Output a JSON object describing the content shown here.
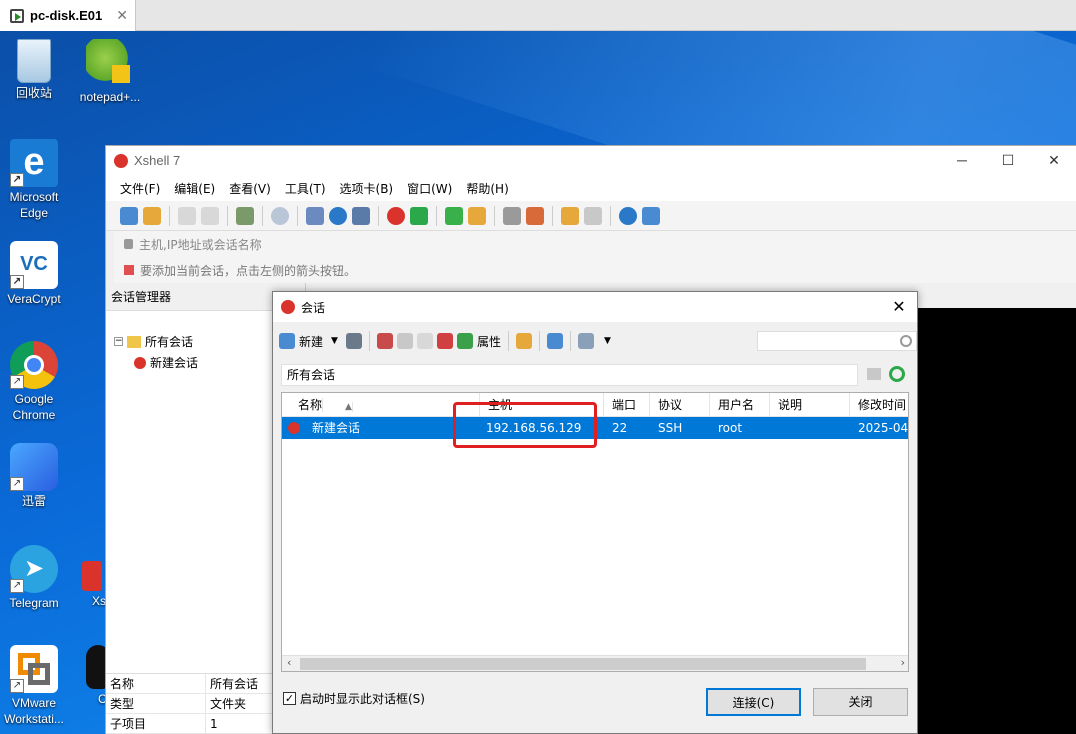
{
  "vm_tab": {
    "title": "pc-disk.E01",
    "close": "✕"
  },
  "desktop_icons": [
    {
      "label": "回收站"
    },
    {
      "label": "notepad+..."
    },
    {
      "label": "Microsoft Edge"
    },
    {
      "label": "VeraCrypt"
    },
    {
      "label": "Google Chrome"
    },
    {
      "label": "迅雷"
    },
    {
      "label": "Telegram"
    },
    {
      "label": "Xs"
    },
    {
      "label": "VMware Workstati..."
    },
    {
      "label": "C"
    }
  ],
  "xshell": {
    "title": "Xshell 7",
    "menu": [
      "文件(F)",
      "编辑(E)",
      "查看(V)",
      "工具(T)",
      "选项卡(B)",
      "窗口(W)",
      "帮助(H)"
    ],
    "address_placeholder": "主机,IP地址或会话名称",
    "hint": "要添加当前会话，点击左侧的箭头按钮。",
    "session_manager": "会话管理器",
    "tree": {
      "root": "所有会话",
      "child": "新建会话"
    },
    "props": [
      {
        "k": "名称",
        "v": "所有会话"
      },
      {
        "k": "类型",
        "v": "文件夹"
      },
      {
        "k": "子项目",
        "v": "1"
      }
    ]
  },
  "dialog": {
    "title": "会话",
    "toolbar": {
      "new": "新建",
      "properties": "属性"
    },
    "path": "所有会话",
    "columns": [
      "名称",
      "主机",
      "端口",
      "协议",
      "用户名",
      "说明",
      "修改时间"
    ],
    "rows": [
      {
        "name": "新建会话",
        "host": "192.168.56.129",
        "port": "22",
        "protocol": "SSH",
        "user": "root",
        "desc": "",
        "modified": "2025-04"
      }
    ],
    "show_on_startup": "启动时显示此对话框(S)",
    "connect": "连接(C)",
    "close": "关闭"
  },
  "colors": {
    "selection": "#0078d7",
    "highlight_box": "#e02020",
    "desktop": "#0a63c9"
  }
}
